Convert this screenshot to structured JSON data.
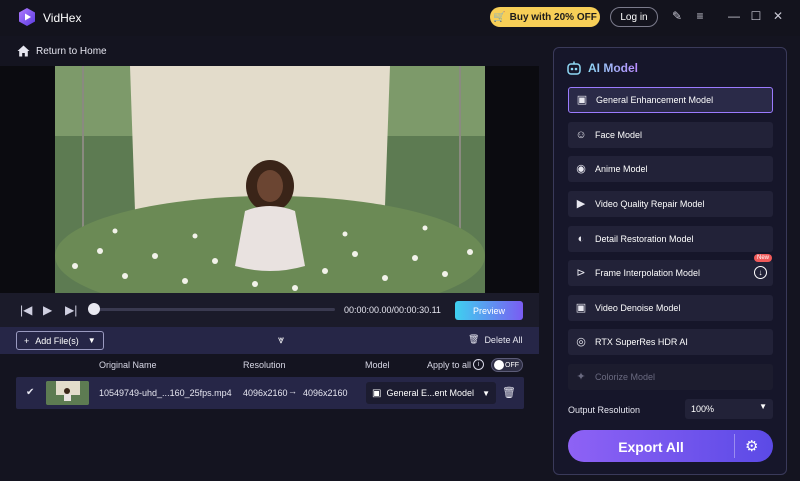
{
  "app": {
    "name": "VidHex"
  },
  "header": {
    "buy_label": "Buy with 20% OFF",
    "login_label": "Log in"
  },
  "nav": {
    "back_label": "Return to Home"
  },
  "player": {
    "timecode": "00:00:00.00/00:00:30.11",
    "preview_label": "Preview",
    "progress_fraction": 0
  },
  "files": {
    "add_label": "Add File(s)",
    "delete_all_label": "Delete All",
    "columns": {
      "original_name": "Original Name",
      "resolution": "Resolution",
      "model": "Model",
      "apply_to_all": "Apply to all"
    },
    "toggle_label": "OFF",
    "rows": [
      {
        "name": "10549749-uhd_...160_25fps.mp4",
        "res_from": "4096x2160",
        "res_to": "4096x2160",
        "model": "General E...ent Model"
      }
    ]
  },
  "ai_panel": {
    "title": "AI Model",
    "models": [
      {
        "label": "General Enhancement Model",
        "icon": "sparkle-video-icon",
        "active": true
      },
      {
        "label": "Face Model",
        "icon": "face-icon"
      },
      {
        "label": "Anime Model",
        "icon": "anime-icon"
      },
      {
        "label": "Video Quality Repair Model",
        "icon": "repair-icon"
      },
      {
        "label": "Detail Restoration Model",
        "icon": "detail-icon"
      },
      {
        "label": "Frame Interpolation Model",
        "icon": "frame-icon",
        "badge": "New"
      },
      {
        "label": "Video Denoise Model",
        "icon": "denoise-icon"
      },
      {
        "label": "RTX SuperRes HDR AI",
        "icon": "nvidia-icon"
      },
      {
        "label": "Colorize Model",
        "icon": "colorize-icon",
        "disabled": true
      }
    ],
    "output_resolution_label": "Output Resolution",
    "output_resolution_value": "100%",
    "export_label": "Export All"
  },
  "colors": {
    "accent": "#8e62f5",
    "buy": "#f7cf57",
    "preview_start": "#3fd0ef"
  }
}
